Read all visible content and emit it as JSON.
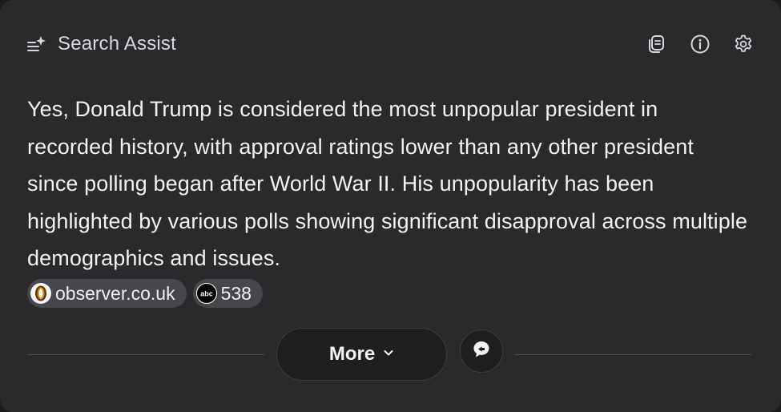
{
  "header": {
    "title": "Search Assist",
    "icons": [
      "assist-sparkle-icon",
      "copy-icon",
      "info-icon",
      "settings-gear-icon"
    ]
  },
  "answer": {
    "text": "Yes, Donald Trump is considered the most unpopular president in recorded history, with approval ratings lower than any other president since polling began after World War II. His unpopularity has been highlighted by various polls showing significant disapproval across multiple demographics and issues."
  },
  "sources": [
    {
      "label": "observer.co.uk",
      "icon": "observer-logo-icon"
    },
    {
      "label": "538",
      "icon": "abc-logo-icon",
      "logo_text": "abc"
    }
  ],
  "footer": {
    "more_label": "More",
    "chat_icon": "chat-bubble-icon"
  },
  "colors": {
    "panel_background": "#2a2a2d",
    "chip_background": "#46464b",
    "text_primary": "#f2f2f4",
    "text_secondary": "#d8d8dc"
  }
}
